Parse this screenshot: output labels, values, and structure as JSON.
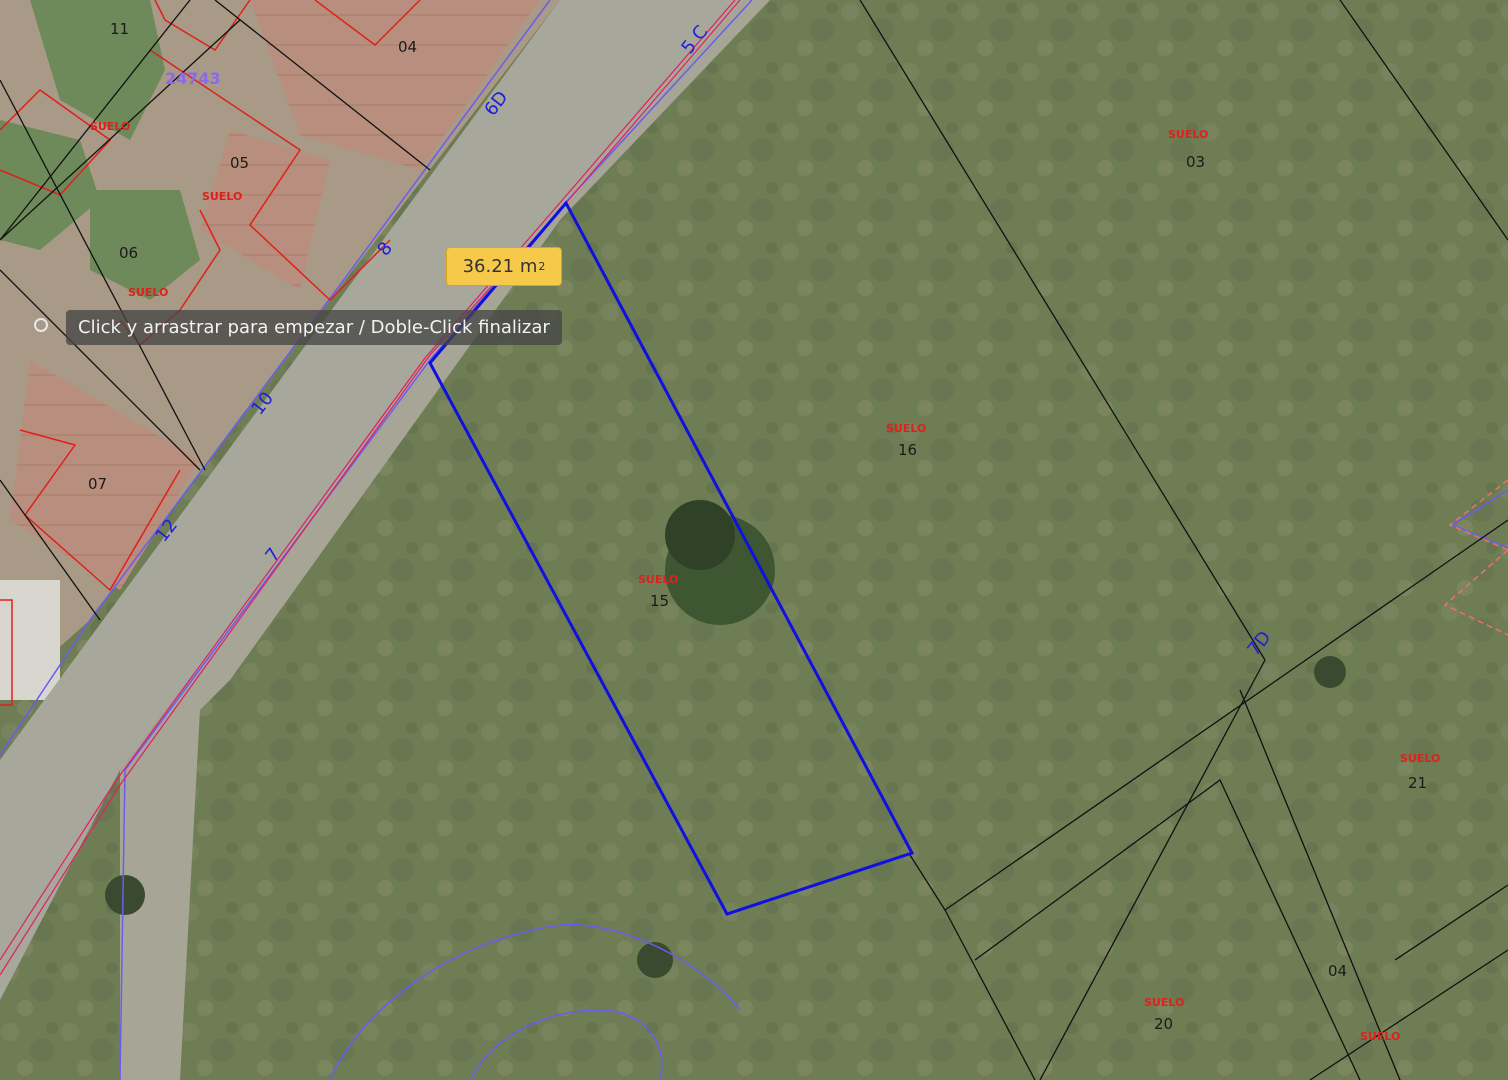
{
  "measurement": {
    "value": "36.21 m",
    "unit_superscript": "2"
  },
  "tooltip": {
    "text": "Click y arrastrar para empezar / Doble-Click finalizar"
  },
  "parcels": [
    {
      "id": "11",
      "type_label": "SUELO"
    },
    {
      "id": "04",
      "type_label": ""
    },
    {
      "id": "05",
      "type_label": "SUELO"
    },
    {
      "id": "06",
      "type_label": "SUELO"
    },
    {
      "id": "07",
      "type_label": ""
    },
    {
      "id": "03",
      "type_label": "SUELO"
    },
    {
      "id": "16",
      "type_label": "SUELO"
    },
    {
      "id": "15",
      "type_label": "SUELO"
    },
    {
      "id": "21",
      "type_label": "SUELO"
    },
    {
      "id": "20",
      "type_label": "SUELO"
    },
    {
      "id": "04",
      "type_label": "SUELO"
    }
  ],
  "street_numbers": [
    "5 C",
    "6D",
    "8",
    "10",
    "12",
    "7",
    "7D"
  ],
  "cadastral_ref": "24743",
  "colors": {
    "measure_polygon": "#1010e0",
    "parcel_border": "#111111",
    "building_border": "#e0201a",
    "street_boundary": "#6a5cf0",
    "badge": "#f6c94a"
  }
}
